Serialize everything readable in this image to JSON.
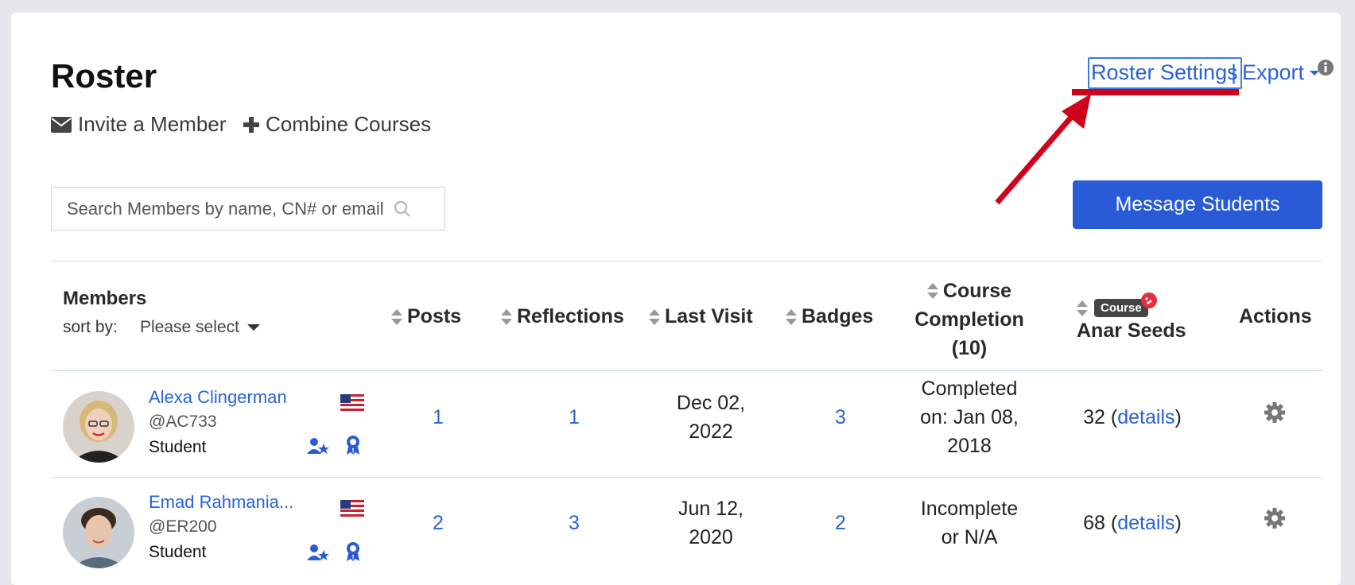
{
  "header": {
    "title": "Roster",
    "roster_settings": "Roster Settings",
    "separator": "|",
    "export": "Export"
  },
  "actions": {
    "invite": "Invite a Member",
    "combine": "Combine Courses"
  },
  "search": {
    "placeholder": "Search Members by name, CN# or email"
  },
  "message_button": "Message Students",
  "table": {
    "members_header": "Members",
    "sort_by_label": "sort by:",
    "sort_by_value": "Please select",
    "columns": {
      "posts": "Posts",
      "reflections": "Reflections",
      "last_visit": "Last Visit",
      "badges": "Badges",
      "completion_line1": "Course",
      "completion_line2": "Completion",
      "completion_line3": "(10)",
      "seeds_badge": "Course",
      "seeds": "Anar Seeds",
      "actions": "Actions"
    },
    "rows": [
      {
        "name": "Alexa Clingerman",
        "handle": "@AC733",
        "role": "Student",
        "posts": "1",
        "reflections": "1",
        "last_visit_1": "Dec 02,",
        "last_visit_2": "2022",
        "badges": "3",
        "completion_1": "Completed",
        "completion_2": "on: Jan 08,",
        "completion_3": "2018",
        "seeds_num": "32 (",
        "seeds_link": "details",
        "seeds_close": ")"
      },
      {
        "name": "Emad Rahmania...",
        "handle": "@ER200",
        "role": "Student",
        "posts": "2",
        "reflections": "3",
        "last_visit_1": "Jun 12,",
        "last_visit_2": "2020",
        "badges": "2",
        "completion_1": "Incomplete",
        "completion_2": "or N/A",
        "completion_3": "",
        "seeds_num": "68 (",
        "seeds_link": "details",
        "seeds_close": ")"
      }
    ]
  },
  "colors": {
    "accent": "#2a62d6",
    "button": "#2a5bd7",
    "annotation": "#d0021b"
  }
}
